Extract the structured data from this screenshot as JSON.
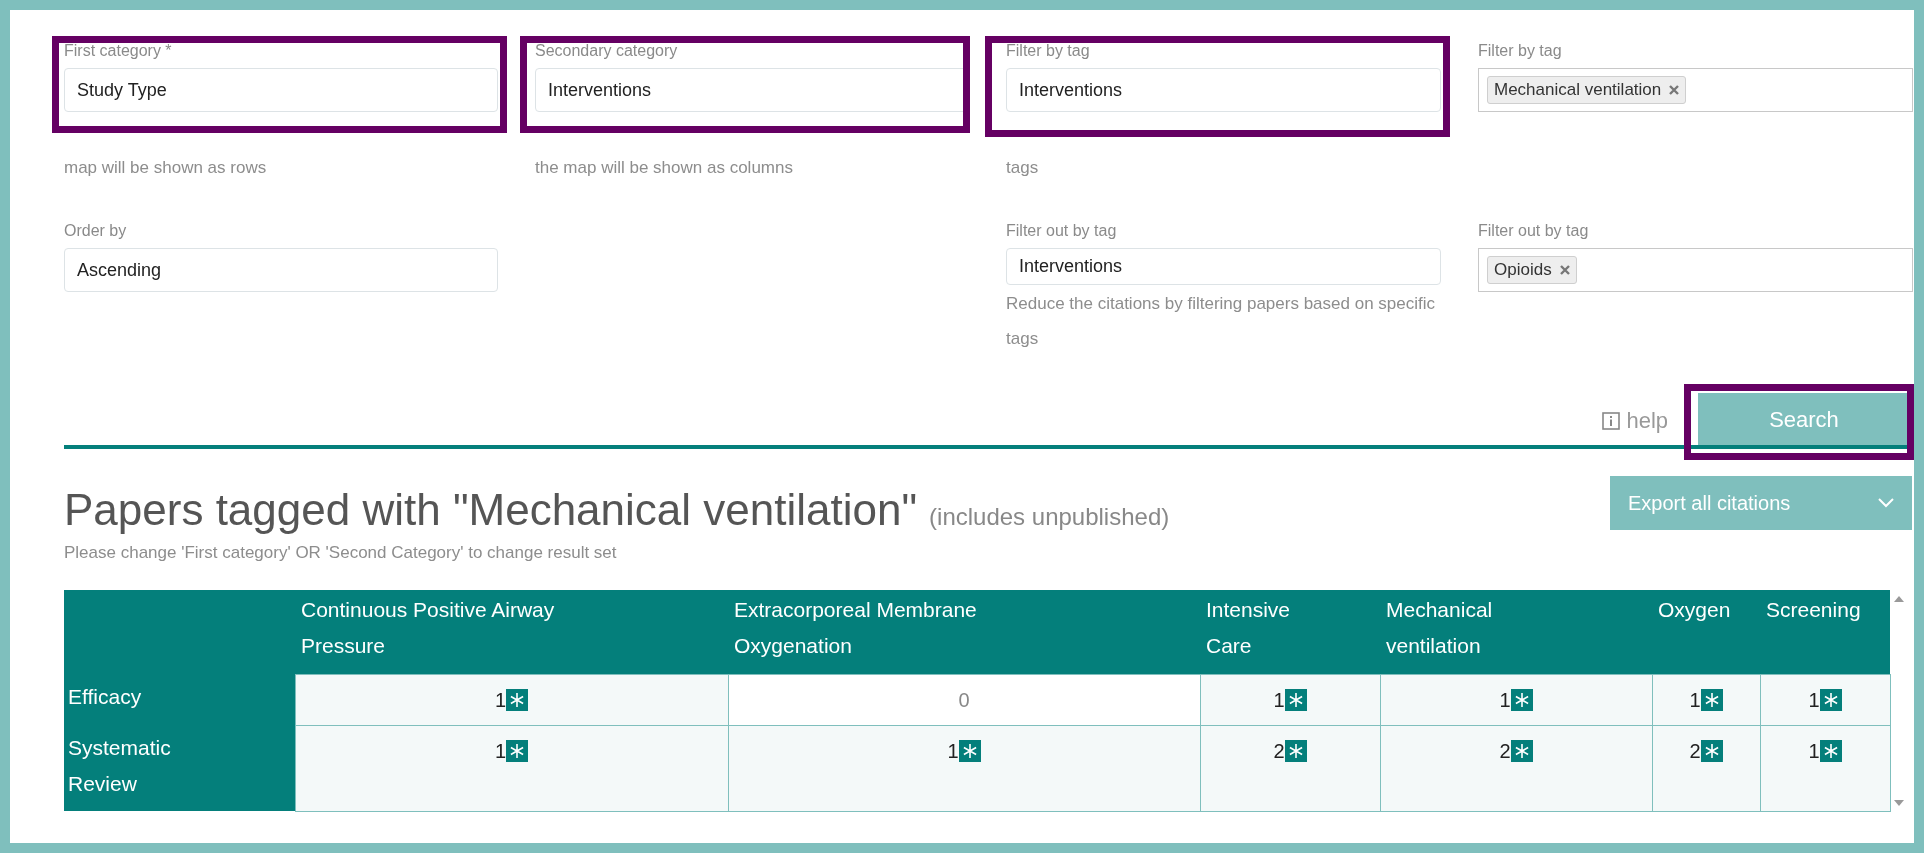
{
  "form": {
    "fields": [
      {
        "label": "First category *",
        "kind": "select",
        "value": "Study Type",
        "help": "map will be shown as rows",
        "highlighted": true
      },
      {
        "label": "Secondary category",
        "kind": "select",
        "value": "Interventions",
        "help": "the map will be shown as columns",
        "highlighted": true
      },
      {
        "label": "Filter by tag",
        "kind": "select",
        "value": "Interventions",
        "help": "tags",
        "highlighted": true
      },
      {
        "label": "Filter by tag",
        "kind": "tags",
        "tags": [
          "Mechanical ventilation"
        ],
        "highlighted": false
      },
      {
        "label": "Order by",
        "kind": "select",
        "value": "Ascending",
        "highlighted": false
      },
      {
        "kind": "empty"
      },
      {
        "label": "Filter out by tag",
        "kind": "select",
        "value": "Interventions",
        "help": "Reduce the citations by filtering papers based on specific tags",
        "highlighted": false
      },
      {
        "label": "Filter out by tag",
        "kind": "tags",
        "tags": [
          "Opioids"
        ],
        "highlighted": false
      }
    ],
    "help_link": "help",
    "search_button": {
      "label": "Search",
      "highlighted": true
    }
  },
  "results": {
    "title": "Papers tagged with \"Mechanical ventilation\"",
    "title_note": "(includes unpublished)",
    "export_button": "Export all citations",
    "hint": "Please change 'First category' OR 'Second Category' to change result set",
    "table": {
      "columns": [
        "Continuous Positive Airway Pressure",
        "Extracorporeal Membrane Oxygenation",
        "Intensive Care",
        "Mechanical ventilation",
        "Oxygen",
        "Screening"
      ],
      "rows": [
        {
          "label": "Efficacy",
          "cells": [
            {
              "value": "1",
              "linked": true
            },
            {
              "value": "0",
              "linked": false
            },
            {
              "value": "1",
              "linked": true
            },
            {
              "value": "1",
              "linked": true
            },
            {
              "value": "1",
              "linked": true
            },
            {
              "value": "1",
              "linked": true
            }
          ]
        },
        {
          "label": "Systematic Review",
          "cells": [
            {
              "value": "1",
              "linked": true
            },
            {
              "value": "1",
              "linked": true
            },
            {
              "value": "2",
              "linked": true
            },
            {
              "value": "2",
              "linked": true
            },
            {
              "value": "2",
              "linked": true
            },
            {
              "value": "1",
              "linked": true
            }
          ]
        }
      ]
    }
  }
}
